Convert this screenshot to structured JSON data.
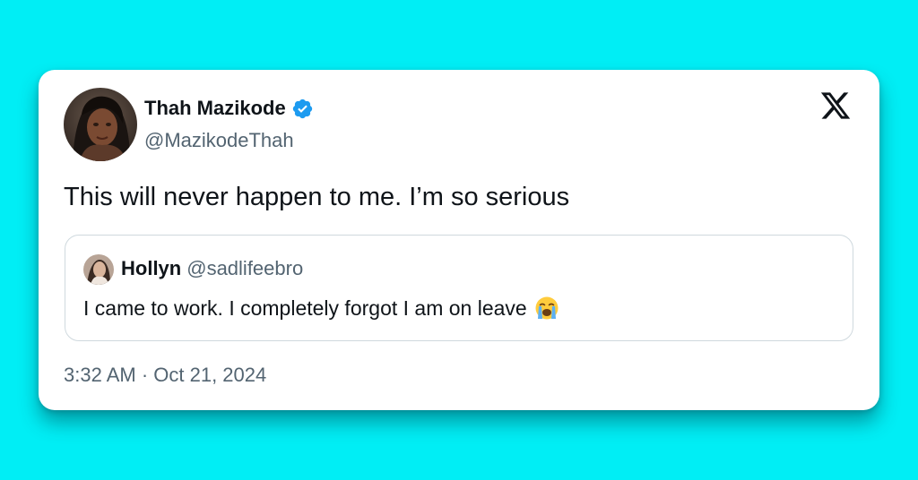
{
  "tweet": {
    "author": {
      "name": "Thah Mazikode",
      "handle": "@MazikodeThah",
      "verified": true,
      "avatar_icon": "profile-photo-avatar"
    },
    "text": "This will never happen to me. I’m so serious",
    "quoted": {
      "name": "Hollyn",
      "handle": "@sadlifeebro",
      "text": "I came to work. I completely forgot I am on leave",
      "emoji_icon": "loudly-crying-face-emoji"
    },
    "timestamp": "3:32 AM · Oct 21, 2024",
    "platform_icon": "x-logo"
  },
  "colors": {
    "background": "#00eef5",
    "card": "#ffffff",
    "verified": "#1d9bf0",
    "primary_text": "#0f1419",
    "secondary_text": "#536471",
    "border": "#cfd9de"
  }
}
